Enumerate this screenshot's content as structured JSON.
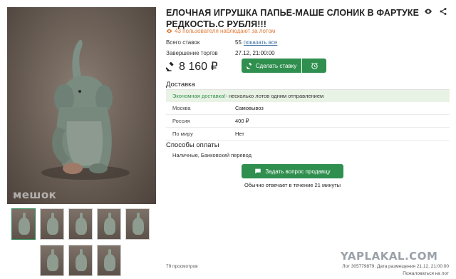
{
  "lot": {
    "title": "ЕЛОЧНАЯ ИГРУШКА ПАПЬЕ-МАШЕ СЛОНИК В ФАРТУКЕ РЕДКОСТЬ.С РУБЛЯ!!!",
    "watchers": "43 пользователя наблюдают за лотом"
  },
  "icons": {
    "watch": "eye-icon",
    "share": "share-icon",
    "hammer": "auction-hammer-icon",
    "clock": "alarm-clock-icon",
    "chat": "chat-icon"
  },
  "auction": {
    "bids_label": "Всего ставок",
    "bids_count": "55",
    "bids_link": "показать все",
    "end_label": "Завершение торгов",
    "end_value": "27.12, 21:00:00",
    "price": "8 160 ₽",
    "bid_button": "Сделать ставку"
  },
  "delivery": {
    "title": "Доставка",
    "eco_highlight": "Экономная доставка!",
    "eco_rest": " - несколько лотов одним отправлением",
    "rows": [
      {
        "region": "Москва",
        "value": "Самовывоз"
      },
      {
        "region": "Россия",
        "value": "400 ₽"
      },
      {
        "region": "По миру",
        "value": "Нет"
      }
    ]
  },
  "payment": {
    "title": "Способы оплаты",
    "methods": "Наличные, Банковский перевод"
  },
  "seller": {
    "ask_button": "Задать вопрос продавцу",
    "reply_note": "Обычно отвечает в течение 21 минуты"
  },
  "footer": {
    "views": "79 просмотров",
    "lot_meta": "Лот 305779879. Дата размещения 21.12, 21:00:00",
    "complain": "Пожаловаться на лот"
  },
  "watermarks": {
    "photo": "мешок",
    "site": "YAPLAKAL.COM"
  },
  "colors": {
    "accent_green": "#2f8f4e",
    "watchers_orange": "#e07b39",
    "eco_bg": "#e9f3e5",
    "link_blue": "#3a6ea5"
  }
}
